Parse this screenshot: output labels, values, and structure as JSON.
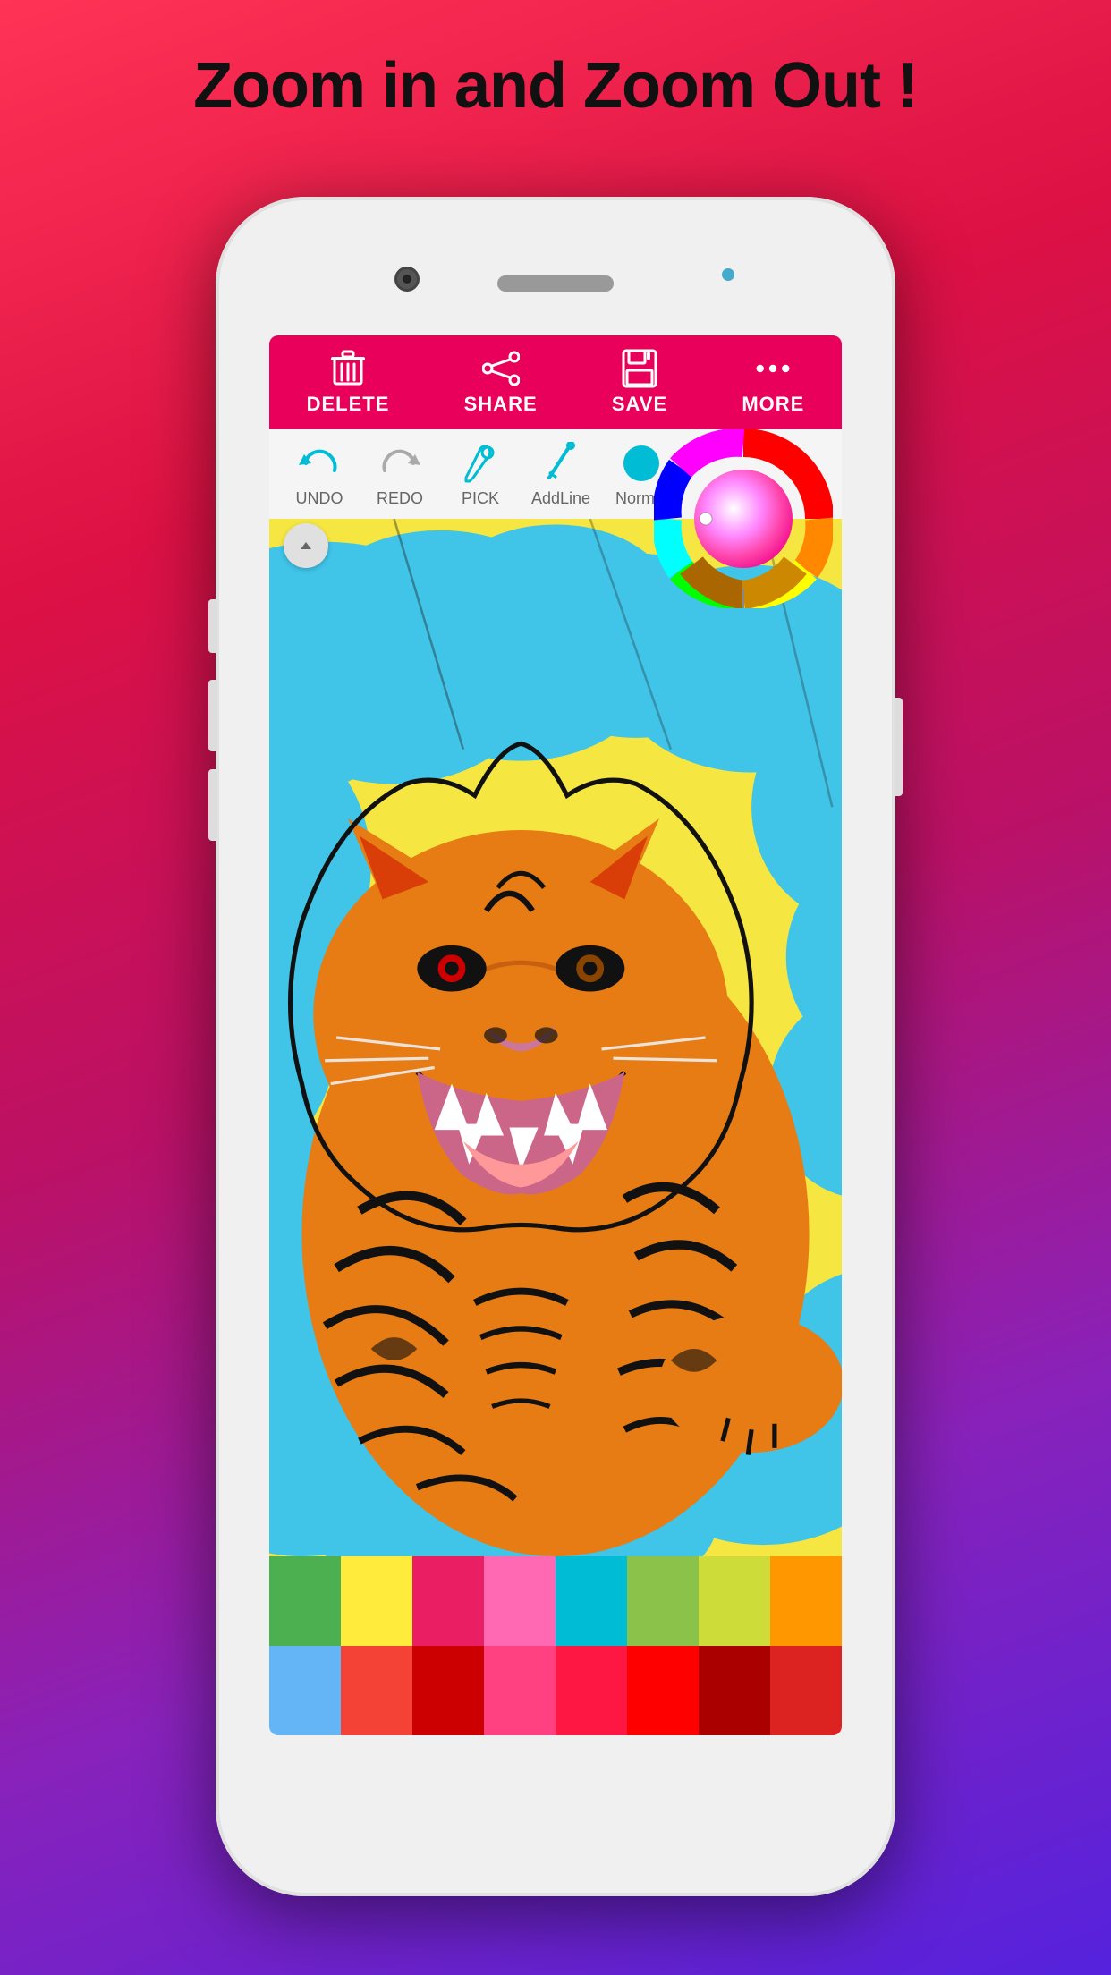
{
  "page": {
    "title": "Zoom in and Zoom Out !",
    "background_gradient_start": "#ff3355",
    "background_gradient_end": "#5522dd"
  },
  "toolbar": {
    "delete_label": "DELETE",
    "share_label": "SHARE",
    "save_label": "SAVE",
    "more_label": "MORE",
    "background_color": "#e8005a"
  },
  "tools": [
    {
      "id": "undo",
      "label": "UNDO",
      "color": "#00bcd4"
    },
    {
      "id": "redo",
      "label": "REDO",
      "color": "#aaaaaa"
    },
    {
      "id": "pick",
      "label": "PICK",
      "color": "#00bcd4"
    },
    {
      "id": "addline",
      "label": "AddLine",
      "color": "#00bcd4"
    },
    {
      "id": "normal",
      "label": "Normal",
      "color": "#00bcd4"
    }
  ],
  "color_wheel": {
    "visible": true
  },
  "color_palette": {
    "colors": [
      "#4caf50",
      "#ffeb3b",
      "#e91e63",
      "#ff69b4",
      "#00bcd4",
      "#4caf50",
      "#cddc39",
      "#ff9800",
      "#64b5f6",
      "#f44336",
      "#cc0000",
      "#ff4081",
      "#ff1744",
      "#ff0000",
      "#aa0000",
      "#dd2222"
    ]
  },
  "canvas": {
    "tiger_colors": {
      "background": "#f5e642",
      "clouds": "#40c4e8",
      "tiger_body": "#e67c13",
      "tiger_stripes": "#111111",
      "outline": "#111111"
    }
  }
}
